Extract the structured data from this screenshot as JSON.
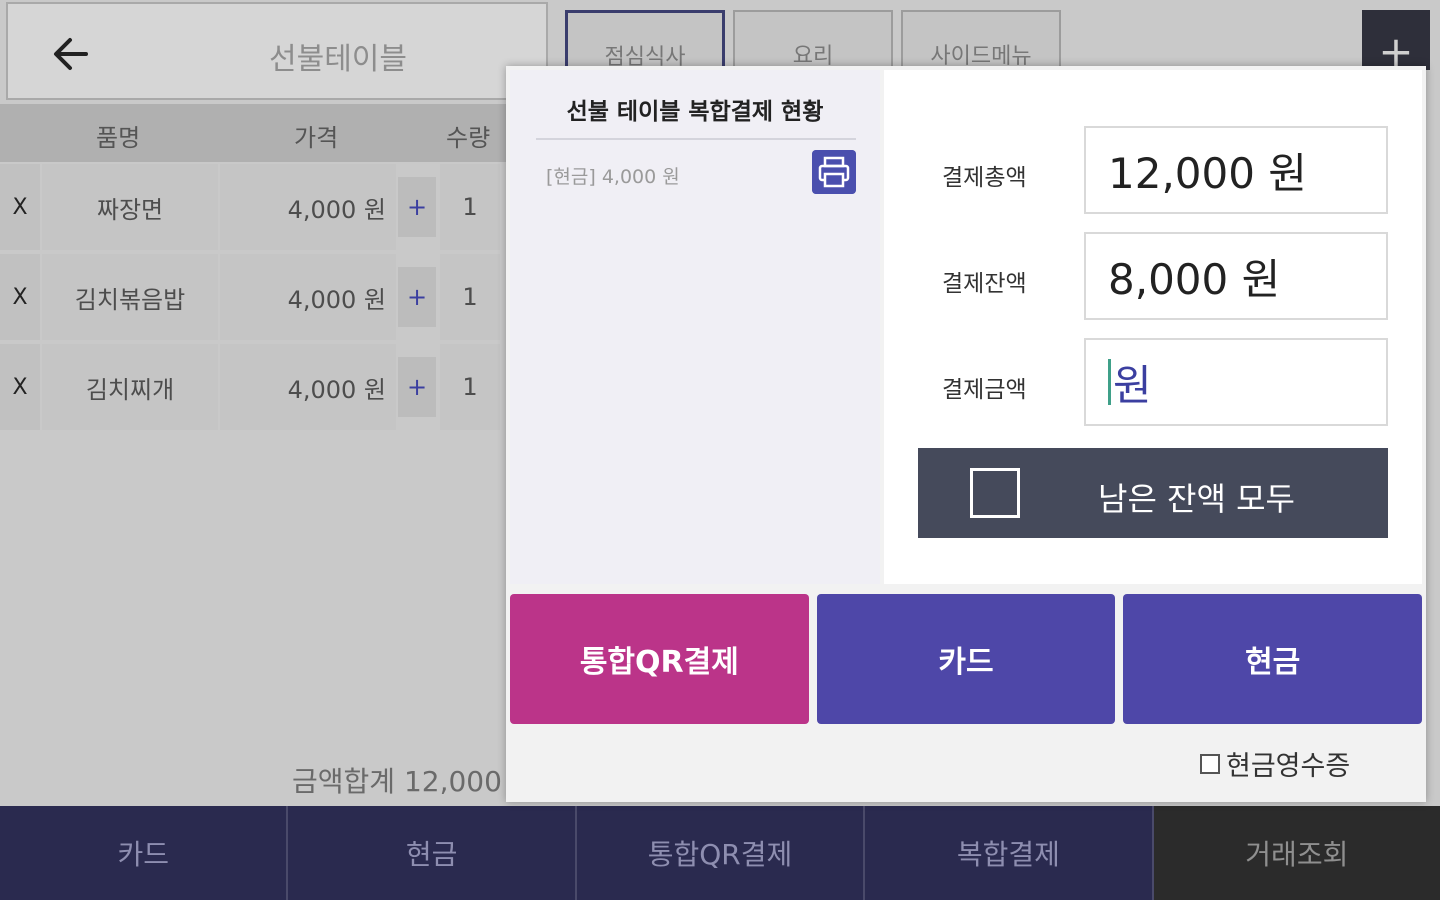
{
  "background": {
    "header_title": "선불테이블",
    "category_tabs": [
      "점심식사",
      "요리",
      "사이드메뉴"
    ],
    "add_button": "+",
    "table_headers": [
      "품명",
      "가격",
      "수량"
    ],
    "rows": [
      {
        "delete": "X",
        "name": "짜장면",
        "price": "4,000 원",
        "plus": "+",
        "qty": "1"
      },
      {
        "delete": "X",
        "name": "김치볶음밥",
        "price": "4,000 원",
        "plus": "+",
        "qty": "1"
      },
      {
        "delete": "X",
        "name": "김치찌개",
        "price": "4,000 원",
        "plus": "+",
        "qty": "1"
      }
    ],
    "sum_label": "금액합계 12,000",
    "bottom_buttons": [
      "카드",
      "현금",
      "통합QR결제",
      "복합결제",
      "거래조회"
    ]
  },
  "modal": {
    "left_title": "선불 테이블 복합결제 현황",
    "payment_entries": [
      "[현금] 4,000 원"
    ],
    "fields": {
      "total_label": "결제총액",
      "total_value": "12,000 원",
      "remain_label": "결제잔액",
      "remain_value": "8,000 원",
      "amount_label": "결제금액",
      "amount_value": "원"
    },
    "remain_all_label": "남은 잔액 모두",
    "buttons": {
      "qr": "통합QR결제",
      "card": "카드",
      "cash": "현금"
    },
    "cash_receipt_label": "현금영수증",
    "colors": {
      "qr": "#bb3489",
      "card": "#4e47a8",
      "cash": "#4e47a8",
      "remain_bar": "#454a5b"
    }
  }
}
